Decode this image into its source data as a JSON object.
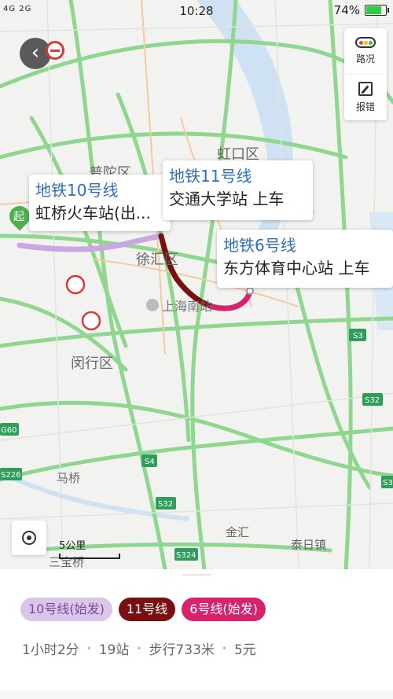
{
  "status_bar": {
    "signal": "4G 2G",
    "time": "10:28",
    "battery": "74%",
    "battery_level": 0.74
  },
  "map": {
    "districts": [
      "虹口区",
      "普陀区",
      "徐汇区",
      "闵行区",
      "金汇",
      "泰日镇",
      "马桥",
      "三宝桥"
    ],
    "poi": "上海南站",
    "highway_labels": [
      "S3",
      "S32",
      "S4",
      "G60",
      "S226",
      "S32",
      "S324",
      "S3",
      "S4"
    ],
    "start_marker": "起",
    "scale_label": "5公里"
  },
  "side_panel": {
    "traffic_label": "路况",
    "report_label": "报错"
  },
  "callouts": [
    {
      "line": "地铁10号线",
      "station": "虹桥火车站(出..."
    },
    {
      "line": "地铁11号线",
      "station": "交通大学站 上车"
    },
    {
      "line": "地铁6号线",
      "station": "东方体育中心站 上车"
    }
  ],
  "route_chips": [
    {
      "label": "10号线(始发)",
      "bg": "#d9c6ea",
      "fg": "#7a4a9a"
    },
    {
      "label": "11号线",
      "bg": "#7a0f0f",
      "fg": "#ffffff"
    },
    {
      "label": "6号线(始发)",
      "bg": "#d6236d",
      "fg": "#ffffff"
    }
  ],
  "summary": {
    "duration": "1小时2分",
    "stops": "19站",
    "walk": "步行733米",
    "fare": "5元"
  },
  "colors": {
    "road_green": "#8fd68f",
    "line10": "#c9a8e0",
    "line11": "#7a0f0f",
    "line6": "#d6236d",
    "callout_line_text": "#2f6fb8"
  }
}
